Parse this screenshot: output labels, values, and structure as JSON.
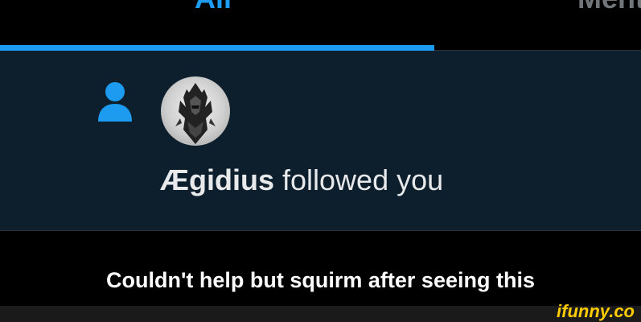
{
  "tabs": [
    {
      "label": "All",
      "active": true
    },
    {
      "label": "Mentions",
      "active": false
    }
  ],
  "notification": {
    "icon": "person-icon",
    "avatar": "armored-helmet-avatar",
    "username": "Ægidius",
    "action": " followed you"
  },
  "caption": "Couldn't help but squirm after seeing this",
  "watermark": "ifunny.co",
  "colors": {
    "accent": "#1d9bf0",
    "card_bg": "#0d1f2d",
    "page_bg": "#000000",
    "text": "#e7e9ea",
    "watermark": "#ffcc00"
  }
}
